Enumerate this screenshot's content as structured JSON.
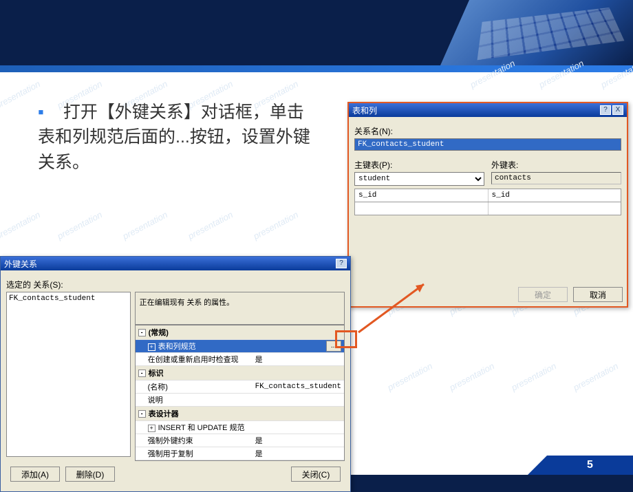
{
  "instruction_text": "打开【外键关系】对话框，单击表和列规范后面的...按钮，设置外键关系。",
  "tc": {
    "title": "表和列",
    "rel_label": "关系名(N):",
    "rel_value": "FK_contacts_student",
    "pk_label": "主键表(P):",
    "pk_value": "student",
    "fk_label": "外键表:",
    "fk_value": "contacts",
    "pk_col": "s_id",
    "fk_col": "s_id",
    "ok": "确定",
    "cancel": "取消"
  },
  "fk": {
    "title": "外键关系",
    "sel_label": "选定的 关系(S):",
    "item": "FK_contacts_student",
    "message": "正在编辑现有 关系 的属性。",
    "cat_general": "(常规)",
    "prop_tc": "表和列规范",
    "prop_check": "在创建或重新启用时检查现",
    "prop_check_v": "是",
    "cat_id": "标识",
    "prop_name": "(名称)",
    "prop_name_v": "FK_contacts_student",
    "prop_desc": "说明",
    "cat_td": "表设计器",
    "prop_iu": "INSERT 和 UPDATE 规范",
    "prop_enf": "强制外键约束",
    "prop_enf_v": "是",
    "prop_rep": "强制用于复制",
    "prop_rep_v": "是",
    "add": "添加(A)",
    "del": "删除(D)",
    "close": "关闭(C)",
    "dots": "..."
  },
  "page_number": "5",
  "watermark": "presentation",
  "help": "?",
  "xbtn": "X"
}
